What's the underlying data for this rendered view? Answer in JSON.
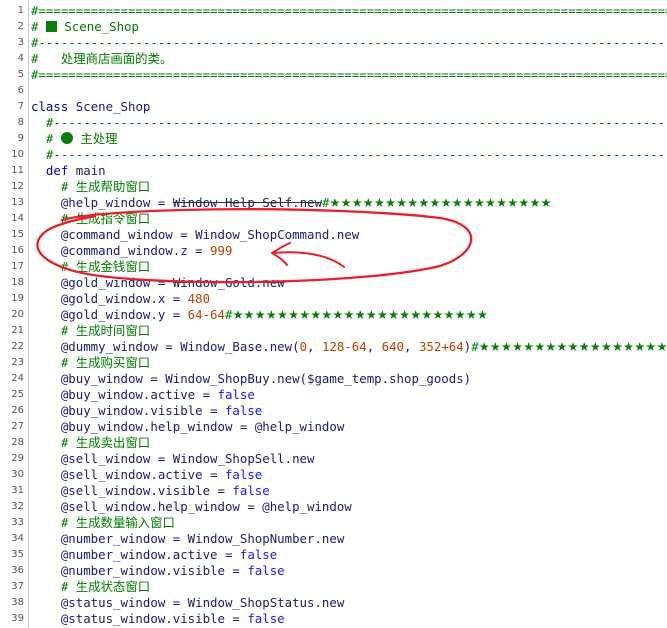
{
  "lines": [
    {
      "n": "1",
      "t": [
        [
          "cm",
          "#==================================================================================================="
        ]
      ]
    },
    {
      "n": "2",
      "t": [
        [
          "cm",
          "# "
        ],
        [
          "sq",
          ""
        ],
        [
          "cm",
          " Scene_Shop"
        ]
      ]
    },
    {
      "n": "3",
      "t": [
        [
          "cm",
          "#---------------------------------------------------------------------------------------------------"
        ]
      ]
    },
    {
      "n": "4",
      "t": [
        [
          "cm",
          "#   处理商店画面的类。"
        ]
      ]
    },
    {
      "n": "5",
      "t": [
        [
          "cm",
          "#==================================================================================================="
        ]
      ]
    },
    {
      "n": "6",
      "t": []
    },
    {
      "n": "7",
      "t": [
        [
          "kw",
          "class"
        ],
        [
          "op",
          " Scene_Shop"
        ]
      ]
    },
    {
      "n": "8",
      "t": [
        [
          "cm",
          "  #-----------------------------------------------------------------------------------------------"
        ]
      ]
    },
    {
      "n": "9",
      "t": [
        [
          "cm",
          "  # "
        ],
        [
          "dot",
          ""
        ],
        [
          "cm",
          " 主处理"
        ]
      ]
    },
    {
      "n": "10",
      "t": [
        [
          "cm",
          "  #-----------------------------------------------------------------------------------------------"
        ]
      ]
    },
    {
      "n": "11",
      "t": [
        [
          "kw",
          "  def"
        ],
        [
          "op",
          " main"
        ]
      ]
    },
    {
      "n": "12",
      "t": [
        [
          "cm",
          "    # 生成帮助窗口"
        ]
      ]
    },
    {
      "n": "13",
      "t": [
        [
          "op",
          "    @help_window = "
        ],
        [
          "strike",
          "Window_Help_Self.new"
        ],
        [
          "cm",
          "#"
        ],
        [
          "star",
          "★★★★★★★★★★★★★★★★★★★★"
        ]
      ]
    },
    {
      "n": "14",
      "t": [
        [
          "cm",
          "    # 生成指令窗口"
        ]
      ]
    },
    {
      "n": "15",
      "t": [
        [
          "op",
          "    @command_window = Window_ShopCommand.new"
        ]
      ]
    },
    {
      "n": "16",
      "t": [
        [
          "op",
          "    @command_window.z = "
        ],
        [
          "num",
          "999"
        ]
      ]
    },
    {
      "n": "17",
      "t": [
        [
          "cm",
          "    # 生成金钱窗口"
        ]
      ]
    },
    {
      "n": "18",
      "t": [
        [
          "op",
          "    @gold_window = "
        ],
        [
          "strike",
          "Window_Gold.new"
        ]
      ]
    },
    {
      "n": "19",
      "t": [
        [
          "op",
          "    @gold_window.x = "
        ],
        [
          "num",
          "480"
        ]
      ]
    },
    {
      "n": "20",
      "t": [
        [
          "op",
          "    @gold_window.y = "
        ],
        [
          "num",
          "64-64"
        ],
        [
          "cm",
          "#"
        ],
        [
          "star",
          "★★★★★★★★★★★★★★★★★★★★★★★"
        ]
      ]
    },
    {
      "n": "21",
      "t": [
        [
          "cm",
          "    # 生成时间窗口"
        ]
      ]
    },
    {
      "n": "22",
      "t": [
        [
          "op",
          "    @dummy_window = Window_Base.new("
        ],
        [
          "num",
          "0"
        ],
        [
          "op",
          ", "
        ],
        [
          "num",
          "128-64"
        ],
        [
          "op",
          ", "
        ],
        [
          "num",
          "640"
        ],
        [
          "op",
          ", "
        ],
        [
          "num",
          "352+64"
        ],
        [
          "op",
          ")"
        ],
        [
          "cm",
          "#"
        ],
        [
          "star",
          "★★★★★★★★★★★★★★★★★★★★★★★★★"
        ]
      ]
    },
    {
      "n": "23",
      "t": [
        [
          "cm",
          "    # 生成购买窗口"
        ]
      ]
    },
    {
      "n": "24",
      "t": [
        [
          "op",
          "    @buy_window = Window_ShopBuy.new("
        ],
        [
          "gv",
          "$game_temp"
        ],
        [
          "op",
          ".shop_goods)"
        ]
      ]
    },
    {
      "n": "25",
      "t": [
        [
          "op",
          "    @buy_window.active = "
        ],
        [
          "lit",
          "false"
        ]
      ]
    },
    {
      "n": "26",
      "t": [
        [
          "op",
          "    @buy_window.visible = "
        ],
        [
          "lit",
          "false"
        ]
      ]
    },
    {
      "n": "27",
      "t": [
        [
          "op",
          "    @buy_window.help_window = @help_window"
        ]
      ]
    },
    {
      "n": "28",
      "t": [
        [
          "cm",
          "    # 生成卖出窗口"
        ]
      ]
    },
    {
      "n": "29",
      "t": [
        [
          "op",
          "    @sell_window = Window_ShopSell.new"
        ]
      ]
    },
    {
      "n": "30",
      "t": [
        [
          "op",
          "    @sell_window.active = "
        ],
        [
          "lit",
          "false"
        ]
      ]
    },
    {
      "n": "31",
      "t": [
        [
          "op",
          "    @sell_window.visible = "
        ],
        [
          "lit",
          "false"
        ]
      ]
    },
    {
      "n": "32",
      "t": [
        [
          "op",
          "    @sell_window.help_window = @help_window"
        ]
      ]
    },
    {
      "n": "33",
      "t": [
        [
          "cm",
          "    # 生成数量输入窗口"
        ]
      ]
    },
    {
      "n": "34",
      "t": [
        [
          "op",
          "    @number_window = Window_ShopNumber.new"
        ]
      ]
    },
    {
      "n": "35",
      "t": [
        [
          "op",
          "    @number_window.active = "
        ],
        [
          "lit",
          "false"
        ]
      ]
    },
    {
      "n": "36",
      "t": [
        [
          "op",
          "    @number_window.visible = "
        ],
        [
          "lit",
          "false"
        ]
      ]
    },
    {
      "n": "37",
      "t": [
        [
          "cm",
          "    # 生成状态窗口"
        ]
      ]
    },
    {
      "n": "38",
      "t": [
        [
          "op",
          "    @status_window = Window_ShopStatus.new"
        ]
      ]
    },
    {
      "n": "39",
      "t": [
        [
          "op",
          "    @status_window.visible = "
        ],
        [
          "lit",
          "false"
        ]
      ]
    }
  ],
  "colors": {
    "comment": "#007e00",
    "keyword": "#0000a0",
    "number": "#c04000",
    "literal": "#1818ff",
    "identifier": "#1a1a7a",
    "annotation": "#e8202a"
  },
  "icons": {
    "square": "green-square-icon",
    "circle": "green-circle-icon",
    "star": "green-star-icon"
  }
}
